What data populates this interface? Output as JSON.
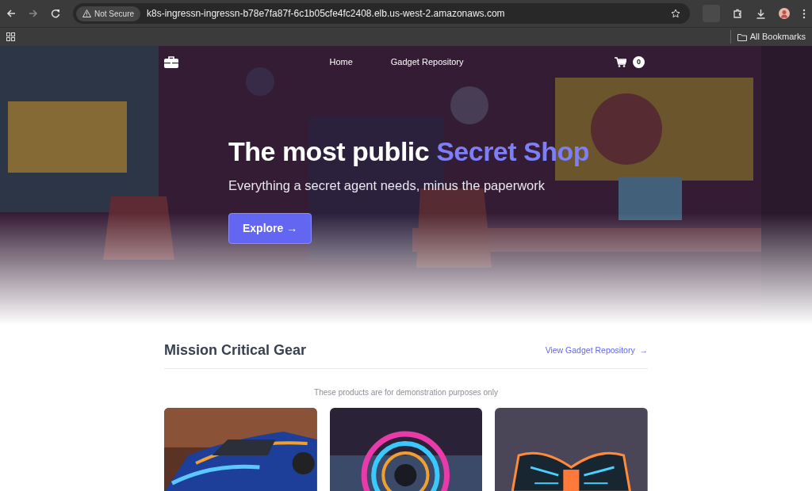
{
  "browser": {
    "security_label": "Not Secure",
    "url": "k8s-ingressn-ingressn-b78e7fa87f-6c1b05cfe4fc2408.elb.us-west-2.amazonaws.com",
    "bookmarks_folder": "All Bookmarks"
  },
  "nav": {
    "links": [
      {
        "label": "Home"
      },
      {
        "label": "Gadget Repository"
      }
    ],
    "cart_count": "0"
  },
  "hero": {
    "title": "The most public",
    "title_highlight": "Secret Shop",
    "subtitle": "Everything a secret agent needs, minus the paperwork",
    "button": {
      "label": "Explore",
      "arrow": "→"
    }
  },
  "section": {
    "heading": "Mission Critical Gear",
    "link": {
      "label": "View Gadget Repository",
      "arrow": "→"
    },
    "note": "These products are for demonstration purposes only"
  }
}
